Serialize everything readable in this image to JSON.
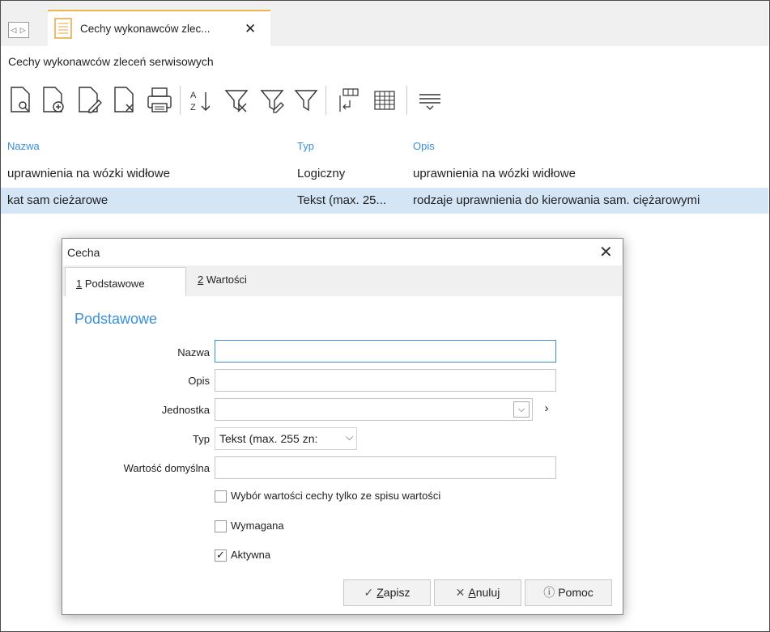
{
  "tab": {
    "title": "Cechy wykonawców zlec..."
  },
  "breadcrumb": "Cechy wykonawców zleceń serwisowych",
  "toolbar": {
    "icons": [
      "preview-icon",
      "add-icon",
      "edit-icon",
      "delete-icon",
      "print-icon",
      "sort-az-icon",
      "filter-clear-icon",
      "filter-edit-icon",
      "filter-icon",
      "columns-icon",
      "grid-icon",
      "filter-row-icon"
    ]
  },
  "grid": {
    "headers": [
      "Nazwa",
      "Typ",
      "Opis"
    ],
    "rows": [
      [
        "uprawnienia na wózki widłowe",
        "Logiczny",
        "uprawnienia na wózki widłowe"
      ],
      [
        "kat sam cieżarowe",
        "Tekst (max. 25...",
        "rodzaje uprawnienia do kierowania sam. ciężarowymi"
      ]
    ]
  },
  "dialog": {
    "title": "Cecha",
    "tabs": [
      {
        "num": "1",
        "label": " Podstawowe"
      },
      {
        "num": "2",
        "label": " Wartości"
      }
    ],
    "section": "Podstawowe",
    "fields": {
      "nazwa_label": "Nazwa",
      "nazwa_value": "",
      "opis_label": "Opis",
      "opis_value": "",
      "jednostka_label": "Jednostka",
      "jednostka_value": "",
      "typ_label": "Typ",
      "typ_value": "Tekst (max. 255 zn:",
      "wartosc_label": "Wartość domyślna",
      "wartosc_value": ""
    },
    "checks": [
      {
        "label": "Wybór wartości cechy tylko ze spisu wartości",
        "checked": false
      },
      {
        "label": "Wymagana",
        "checked": false
      },
      {
        "label": "Aktywna",
        "checked": true
      }
    ],
    "buttons": {
      "save_u": "Z",
      "save_rest": "apisz",
      "cancel_u": "A",
      "cancel_rest": "nuluj",
      "help": "Pomoc"
    }
  }
}
